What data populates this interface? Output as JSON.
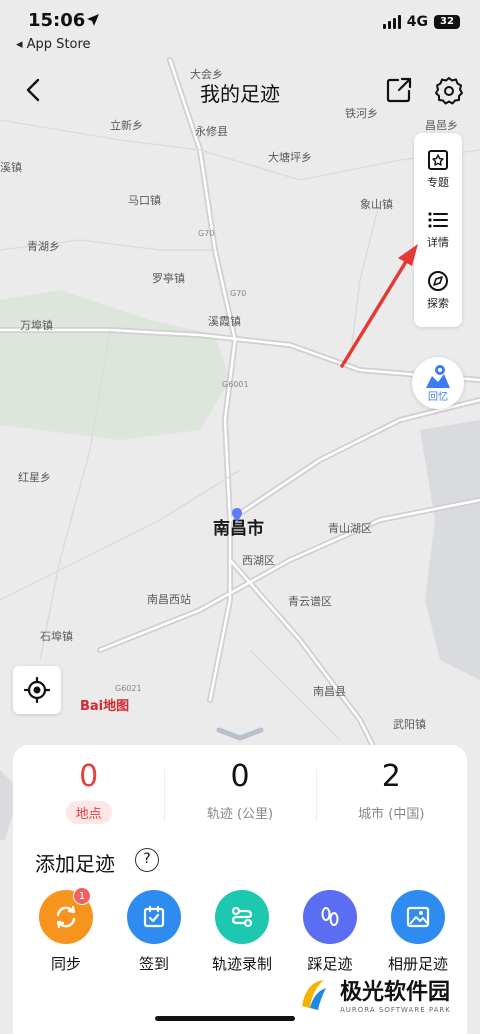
{
  "status_bar": {
    "time": "15:06",
    "back_app": "◂ App Store",
    "network": "4G",
    "battery": "32"
  },
  "header": {
    "title": "我的足迹"
  },
  "map": {
    "city": "南昌市",
    "labels": [
      "立新乡",
      "永修县",
      "铁河乡",
      "昌邑乡",
      "大塘坪乡",
      "马口镇",
      "象山镇",
      "青湖乡",
      "罗亭镇",
      "万埠镇",
      "溪霞镇",
      "红星乡",
      "青山湖区",
      "西湖区",
      "南昌西站",
      "青云谱区",
      "石埠镇",
      "南昌县",
      "武阳镇",
      "溪镇",
      "大会乡"
    ],
    "roads": [
      "G70",
      "G70",
      "G6001",
      "G6021"
    ],
    "logo": "Bai地图"
  },
  "tools": [
    {
      "label": "专题",
      "icon": "topic-icon"
    },
    {
      "label": "详情",
      "icon": "list-icon"
    },
    {
      "label": "探索",
      "icon": "explore-icon"
    }
  ],
  "memory": {
    "label": "回忆"
  },
  "stats": [
    {
      "value": "0",
      "label": "地点"
    },
    {
      "value": "0",
      "label": "轨迹 (公里)"
    },
    {
      "value": "2",
      "label": "城市 (中国)"
    }
  ],
  "add_footprint": {
    "title": "添加足迹",
    "help": "?",
    "actions": [
      {
        "label": "同步",
        "color": "#f7941d",
        "badge": "1"
      },
      {
        "label": "签到",
        "color": "#2e8cf0"
      },
      {
        "label": "轨迹录制",
        "color": "#1ec8b0"
      },
      {
        "label": "踩足迹",
        "color": "#5b6df2"
      },
      {
        "label": "相册足迹",
        "color": "#2e8cf0"
      }
    ]
  },
  "watermark": {
    "name": "极光软件园",
    "sub": "AURORA SOFTWARE PARK"
  },
  "colors": {
    "accent_red": "#e4413c",
    "arrow": "#e53935"
  }
}
